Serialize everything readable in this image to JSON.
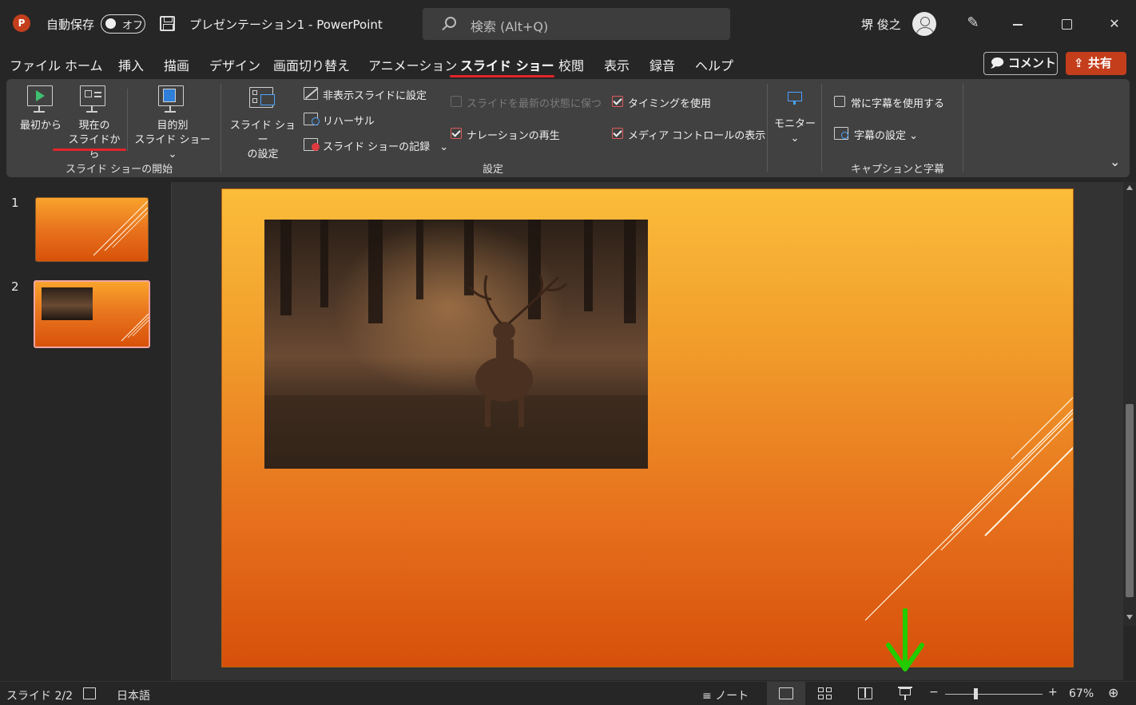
{
  "titlebar": {
    "logo_letter": "P",
    "autosave_label": "自動保存",
    "autosave_state": "オフ",
    "document_title": "プレゼンテーション1  -  PowerPoint",
    "search_placeholder": "検索 (Alt+Q)",
    "user_name": "堺 俊之",
    "close_glyph": "✕"
  },
  "tabs": [
    {
      "label": "ファイル"
    },
    {
      "label": "ホーム"
    },
    {
      "label": "挿入"
    },
    {
      "label": "描画"
    },
    {
      "label": "デザイン"
    },
    {
      "label": "画面切り替え"
    },
    {
      "label": "アニメーション"
    },
    {
      "label": "スライド ショー",
      "active": true
    },
    {
      "label": "校閲"
    },
    {
      "label": "表示"
    },
    {
      "label": "録音"
    },
    {
      "label": "ヘルプ"
    }
  ],
  "actions": {
    "comment_label": "コメント",
    "share_label": "共有"
  },
  "ribbon": {
    "start_group": {
      "label": "スライド ショーの開始",
      "from_beginning": "最初から",
      "from_current_line1": "現在の",
      "from_current_line2": "スライドから",
      "custom_line1": "目的別",
      "custom_line2": "スライド ショー"
    },
    "setup_group": {
      "label": "設定",
      "setup_line1": "スライド ショー",
      "setup_line2": "の設定",
      "hide_slide": "非表示スライドに設定",
      "rehearse": "リハーサル",
      "record": "スライド ショーの記録",
      "keep_fresh": "スライドを最新の状態に保つ",
      "play_narrations": "ナレーションの再生",
      "use_timings": "タイミングを使用",
      "show_media_controls": "メディア コントロールの表示"
    },
    "monitor_group": {
      "label": "モニター"
    },
    "captions_group": {
      "label": "キャプションと字幕",
      "always_use_subtitles": "常に字幕を使用する",
      "subtitle_settings": "字幕の設定"
    },
    "checkboxes": {
      "keep_fresh": false,
      "play_narrations": true,
      "use_timings": true,
      "show_media_controls": true,
      "always_use_subtitles": false
    }
  },
  "thumbnails": [
    {
      "number": "1",
      "selected": false
    },
    {
      "number": "2",
      "selected": true
    }
  ],
  "statusbar": {
    "slide_info": "スライド 2/2",
    "language": "日本語",
    "notes_label": "ノート",
    "zoom_minus": "−",
    "zoom_plus": "+",
    "zoom_level": "67%"
  },
  "colors": {
    "accent_red": "#c43e1c",
    "active_underline": "#e3242b",
    "annotation_arrow": "#22cc00",
    "ribbon_bg": "#414141",
    "window_bg": "#262626"
  }
}
